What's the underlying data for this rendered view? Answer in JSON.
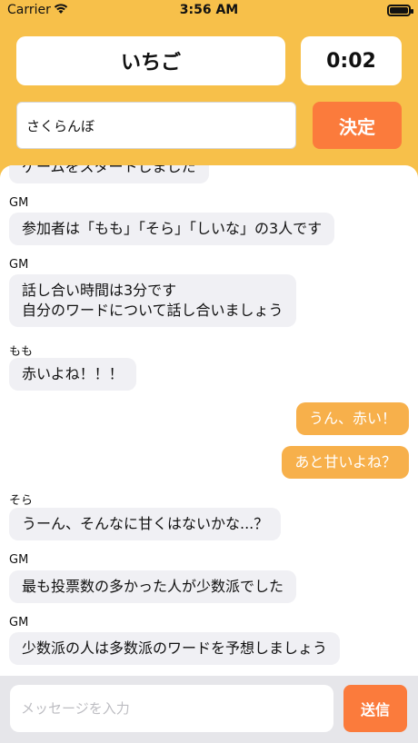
{
  "status_bar": {
    "carrier": "Carrier",
    "time": "3:56 AM",
    "wifi_icon": "wifi-icon",
    "battery_icon": "battery-icon"
  },
  "game": {
    "word": "いちご",
    "timer": "0:02"
  },
  "answer": {
    "value": "さくらんぼ",
    "button_label": "決定"
  },
  "messages": [
    {
      "sender": "",
      "text": "ゲームをスタートしました",
      "mine": false
    },
    {
      "sender": "GM",
      "text": "参加者は「もも」「そら」「しいな」の3人です",
      "mine": false
    },
    {
      "sender": "GM",
      "text": "話し合い時間は3分です\n自分のワードについて話し合いましょう",
      "mine": false
    },
    {
      "sender": "もも",
      "text": "赤いよね！！！",
      "mine": false
    },
    {
      "sender": "",
      "text": "うん、赤い！",
      "mine": true
    },
    {
      "sender": "",
      "text": "あと甘いよね？",
      "mine": true
    },
    {
      "sender": "そら",
      "text": "うーん、そんなに甘くはないかな...？",
      "mine": false
    },
    {
      "sender": "GM",
      "text": "最も投票数の多かった人が少数派でした",
      "mine": false
    },
    {
      "sender": "GM",
      "text": "少数派の人は多数派のワードを予想しましょう",
      "mine": false
    }
  ],
  "composer": {
    "placeholder": "メッセージを入力",
    "send_label": "送信"
  },
  "colors": {
    "background": "#f7c04a",
    "accent_button": "#fb7b3c",
    "my_bubble": "#f7b04b",
    "other_bubble": "#f0f0f4"
  }
}
